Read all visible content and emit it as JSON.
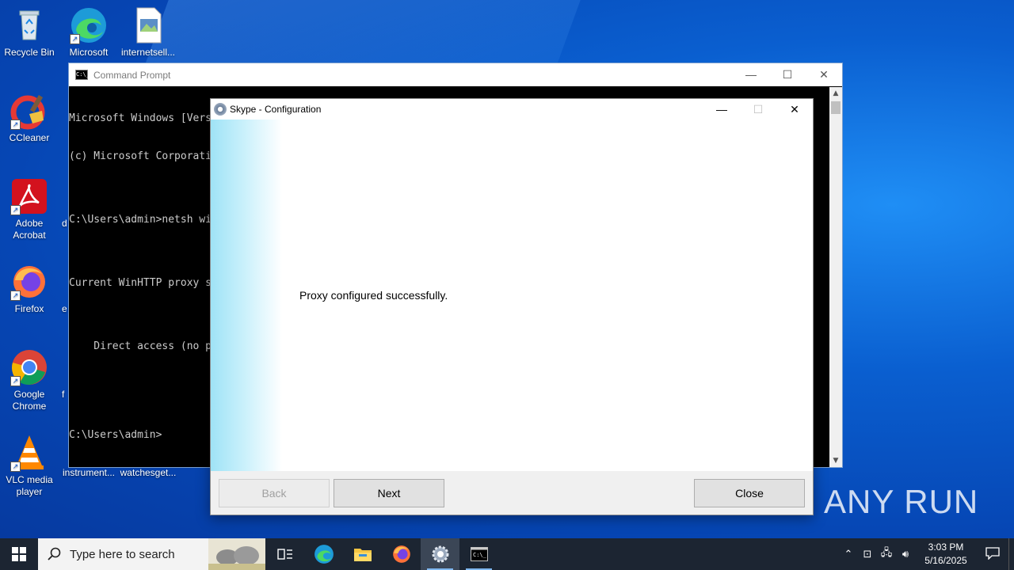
{
  "desktop": {
    "icons": [
      {
        "label": "Recycle Bin"
      },
      {
        "label": "Microsoft Edge"
      },
      {
        "label": "internetsell..."
      },
      {
        "label": "CCleaner"
      },
      {
        "label": "Adobe Acrobat"
      },
      {
        "label": "Firefox"
      },
      {
        "label": "Google Chrome"
      },
      {
        "label": "VLC media player"
      },
      {
        "label": "instrument..."
      },
      {
        "label": "watchesget..."
      }
    ],
    "peek_letters": [
      "d",
      "e",
      "f"
    ]
  },
  "cmd": {
    "title": "Command Prompt",
    "icon_text": "C:\\_",
    "lines": [
      "Microsoft Windows [Version 10.0.19045.4046]",
      "(c) Microsoft Corporati",
      "",
      "C:\\Users\\admin>netsh wi",
      "",
      "Current WinHTTP proxy s",
      "",
      "    Direct access (no p",
      "",
      "",
      "C:\\Users\\admin>"
    ]
  },
  "dialog": {
    "title": "Skype - Configuration",
    "message": "Proxy configured successfully.",
    "back_label": "Back",
    "next_label": "Next",
    "close_label": "Close"
  },
  "watermark": {
    "text": "ANY RUN"
  },
  "taskbar": {
    "search_placeholder": "Type here to search",
    "time": "3:03 PM",
    "date": "5/16/2025"
  },
  "colors": {
    "desktop": "#0a5fd0",
    "taskbar": "#1c2532",
    "console_text": "#cccccc",
    "dialog_side": "#9fe3f6"
  }
}
